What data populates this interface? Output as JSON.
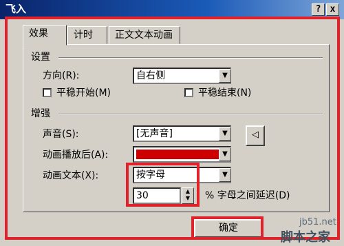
{
  "window": {
    "title": "飞入",
    "help_glyph": "?",
    "close_glyph": "x"
  },
  "tabs": [
    {
      "label": "效果"
    },
    {
      "label": "计时"
    },
    {
      "label": "正文文本动画"
    }
  ],
  "settings": {
    "section_label": "设置",
    "direction_label": "方向(R):",
    "direction_value": "自右侧",
    "smooth_start_label": "平稳开始(M)",
    "smooth_end_label": "平稳结束(N)"
  },
  "enhancement": {
    "section_label": "增强",
    "sound_label": "声音(S):",
    "sound_value": "[无声音]",
    "after_anim_label": "动画播放后(A):",
    "after_anim_color": "#cc0000",
    "anim_text_label": "动画文本(X):",
    "anim_text_value": "按字母",
    "delay_value": "30",
    "delay_suffix": "% 字母之间延迟(D)"
  },
  "buttons": {
    "ok_label": "确定"
  },
  "watermark": {
    "site": "jb51.net",
    "brand": "脚本之家"
  },
  "colors": {
    "highlight_frame": "#e0222a",
    "title_bar": "#0a246a"
  }
}
